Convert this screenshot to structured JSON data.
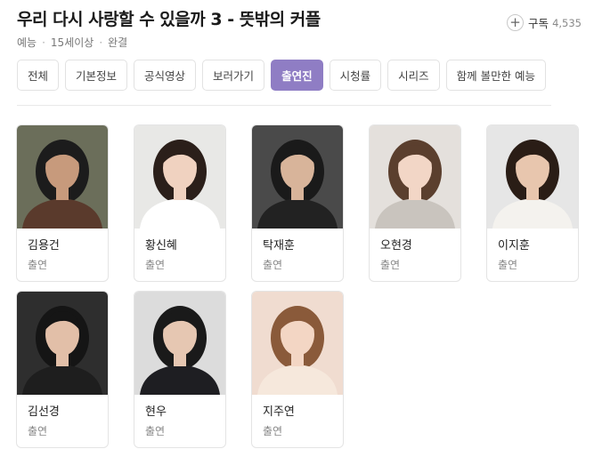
{
  "header": {
    "title": "우리 다시 사랑할 수 있을까 3 - 뜻밖의 커플",
    "meta": [
      "예능",
      "15세이상",
      "완결"
    ],
    "subscribe_label": "구독",
    "subscribe_count": "4,535"
  },
  "tabs": [
    {
      "label": "전체",
      "active": false
    },
    {
      "label": "기본정보",
      "active": false
    },
    {
      "label": "공식영상",
      "active": false
    },
    {
      "label": "보러가기",
      "active": false
    },
    {
      "label": "출연진",
      "active": true
    },
    {
      "label": "시청률",
      "active": false
    },
    {
      "label": "시리즈",
      "active": false
    },
    {
      "label": "함께 볼만한 예능",
      "active": false
    }
  ],
  "cast": [
    {
      "name": "김용건",
      "role": "출연",
      "bg": "#6b6e5a",
      "skin": "#c79a7c",
      "hair": "#1c1c1c",
      "cloth": "#5a3a2c"
    },
    {
      "name": "황신혜",
      "role": "출연",
      "bg": "#e8e8e6",
      "skin": "#f0d2c0",
      "hair": "#2b1f1a",
      "cloth": "#ffffff"
    },
    {
      "name": "탁재훈",
      "role": "출연",
      "bg": "#4a4a4a",
      "skin": "#d8b49a",
      "hair": "#1a1a1a",
      "cloth": "#222222"
    },
    {
      "name": "오현경",
      "role": "출연",
      "bg": "#e4e0dc",
      "skin": "#f2d6c6",
      "hair": "#5b3f2e",
      "cloth": "#c9c4be"
    },
    {
      "name": "이지훈",
      "role": "출연",
      "bg": "#e6e6e6",
      "skin": "#e8c6ae",
      "hair": "#2a1d16",
      "cloth": "#f4f2ee"
    },
    {
      "name": "김선경",
      "role": "출연",
      "bg": "#2e2e2e",
      "skin": "#e2bfa8",
      "hair": "#151515",
      "cloth": "#1e1e1e"
    },
    {
      "name": "현우",
      "role": "출연",
      "bg": "#dcdcdc",
      "skin": "#e6c7b2",
      "hair": "#1a1a1a",
      "cloth": "#1e1e22"
    },
    {
      "name": "지주연",
      "role": "출연",
      "bg": "#f0dcd0",
      "skin": "#f3d6c4",
      "hair": "#8a5a3a",
      "cloth": "#f6e8dc"
    }
  ]
}
